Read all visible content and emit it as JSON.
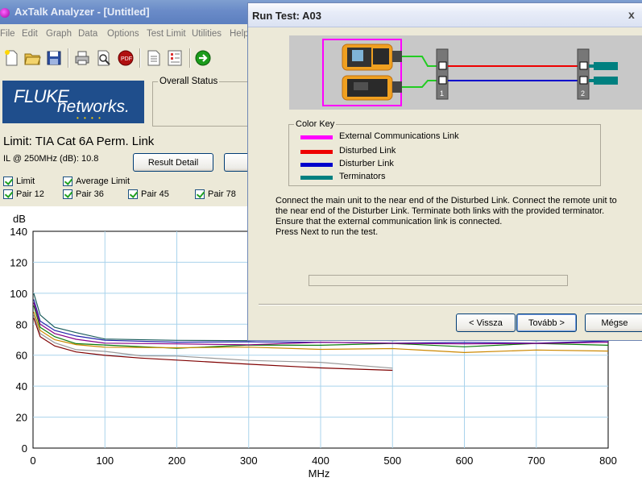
{
  "main_window": {
    "title": "AxTalk Analyzer - [Untitled]",
    "menu": [
      "File",
      "Edit",
      "Graph",
      "Data",
      "Options",
      "Test Limit",
      "Utilities",
      "Help"
    ],
    "toolbar_icons": [
      "new-file-icon",
      "open-folder-icon",
      "save-icon",
      "print-icon",
      "print-preview-icon",
      "pdf-icon",
      "document-icon",
      "report-icon",
      "go-arrow-icon"
    ],
    "logo": {
      "line1": "FLUKE",
      "line2": "networks."
    },
    "overall_status_label": "Overall Status",
    "limit_title": "Limit: TIA Cat 6A Perm. Link",
    "il_label": "IL @ 250MHz (dB):",
    "il_value": "10.8",
    "result_detail_button": "Result Detail",
    "checkboxes": {
      "limit": "Limit",
      "average_limit": "Average Limit",
      "pair12": "Pair 12",
      "pair36": "Pair 36",
      "pair45": "Pair 45",
      "pair78": "Pair 78"
    }
  },
  "chart_data": {
    "type": "line",
    "ylabel": "dB",
    "xlabel": "MHz",
    "xlim": [
      0,
      800
    ],
    "ylim": [
      0,
      140
    ],
    "xticks": [
      0,
      100,
      200,
      300,
      400,
      500,
      600,
      700,
      800
    ],
    "yticks": [
      0,
      20,
      40,
      60,
      80,
      100,
      120,
      140
    ],
    "grid": true,
    "series": [
      {
        "color": "#7f0000",
        "x": [
          1,
          10,
          30,
          60,
          100,
          150,
          200,
          300,
          400,
          500
        ],
        "y": [
          84,
          72,
          66,
          62,
          60,
          58,
          57,
          54,
          52,
          50
        ]
      },
      {
        "color": "#999999",
        "x": [
          1,
          10,
          30,
          60,
          100,
          150,
          200,
          300,
          400,
          500
        ],
        "y": [
          86,
          74,
          68,
          64,
          62,
          60,
          59,
          57,
          55,
          52
        ]
      },
      {
        "color": "#0a7a0a",
        "x": [
          1,
          10,
          30,
          60,
          100,
          200,
          300,
          400,
          500,
          600,
          700,
          800
        ],
        "y": [
          92,
          78,
          72,
          68,
          66,
          65,
          66,
          67,
          67,
          66,
          67,
          67
        ]
      },
      {
        "color": "#cc8800",
        "x": [
          1,
          10,
          30,
          60,
          100,
          200,
          300,
          400,
          500,
          600,
          700,
          800
        ],
        "y": [
          88,
          76,
          70,
          67,
          65,
          65,
          65,
          64,
          64,
          62,
          63,
          63
        ]
      },
      {
        "color": "#2222aa",
        "x": [
          1,
          10,
          30,
          60,
          100,
          200,
          300,
          400,
          500,
          600,
          700,
          800
        ],
        "y": [
          96,
          82,
          76,
          72,
          70,
          68,
          69,
          68,
          68,
          68,
          68,
          69
        ]
      },
      {
        "color": "#1a5c5c",
        "x": [
          1,
          10,
          30,
          60,
          100,
          200,
          300,
          400,
          500,
          600,
          700,
          800
        ],
        "y": [
          100,
          86,
          78,
          74,
          71,
          69,
          70,
          70,
          70,
          70,
          70,
          70
        ]
      },
      {
        "color": "#880088",
        "x": [
          1,
          10,
          30,
          60,
          100,
          200,
          300,
          400,
          500,
          600,
          700,
          800
        ],
        "y": [
          94,
          80,
          74,
          70,
          68,
          67,
          67,
          68,
          68,
          67,
          68,
          68
        ]
      }
    ]
  },
  "dialog": {
    "title": "Run Test: A03",
    "close_glyph": "x",
    "diagram_labels": [
      "1",
      "2"
    ],
    "color_key_label": "Color Key",
    "color_key": [
      {
        "label": "External Communications Link",
        "color": "#ff00ff"
      },
      {
        "label": "Disturbed Link",
        "color": "#ee0000"
      },
      {
        "label": "Disturber Link",
        "color": "#0000cc"
      },
      {
        "label": "Terminators",
        "color": "#008080"
      }
    ],
    "instructions": [
      "Connect the main unit to the near end of the Disturbed Link.  Connect the remote unit to",
      "the near end of the Disturber Link.  Terminate both links with the provided terminator.",
      "Ensure that the external communication link is connected.",
      "Press Next to run the test."
    ],
    "progress": 0,
    "buttons": {
      "back": "< Vissza",
      "next": "Tovább >",
      "cancel": "Mégse"
    }
  }
}
